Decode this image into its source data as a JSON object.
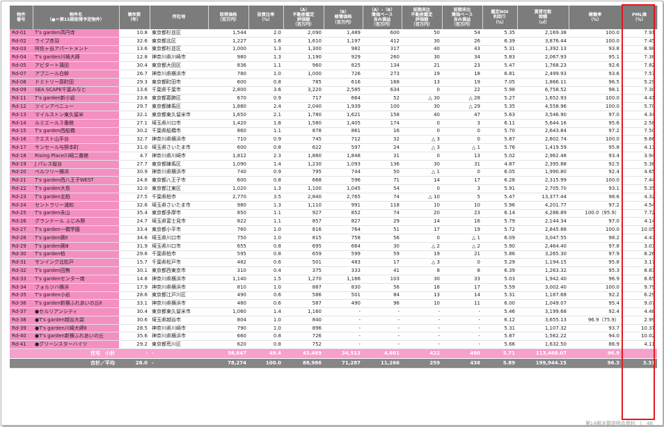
{
  "headers": [
    "物件\n番号",
    "物件名\n（●＝第15期取得予定物件）",
    "築年数\n（年）",
    "所在地",
    "取得価格\n（百万円）",
    "投資比率\n（%）",
    "（A）\n不動産鑑定\n評価額\n（百万円）",
    "（B）\n帳簿価格\n（百万円）",
    "（A）-（B）\n簿価ベース\n含み損益\n（百万円）",
    "前期末比\n不動産鑑定\n評価額\n（百万円）",
    "前期末比\n簿価ベース\n含み損益\n（百万円）",
    "鑑定NOI\n利回り\n（%）",
    "賃貸可能\n面積\n（㎡）",
    "稼働率\n（%）",
    "PML値\n（%）"
  ],
  "rows": [
    [
      "Rd-01",
      "T's garden高円寺",
      "10.8",
      "東京都杉並区",
      "1,544",
      "2.0",
      "2,090",
      "1,489",
      "600",
      "50",
      "54",
      "5.35",
      "2,169.38",
      "100.0",
      "7.91"
    ],
    [
      "Rd-02",
      "ライブ赤羽",
      "32.6",
      "東京都北区",
      "1,227",
      "1.6",
      "1,610",
      "1,197",
      "412",
      "30",
      "26",
      "6.39",
      "3,876.44",
      "100.0",
      "7.45"
    ],
    [
      "Rd-03",
      "阿佐ヶ谷アパートメント",
      "13.6",
      "東京都杉並区",
      "1,000",
      "1.3",
      "1,300",
      "982",
      "317",
      "40",
      "43",
      "5.31",
      "1,392.13",
      "93.8",
      "8.98"
    ],
    [
      "Rd-04",
      "T's garden川崎大師",
      "12.8",
      "神奈川県川崎市",
      "980",
      "1.3",
      "1,190",
      "929",
      "260",
      "30",
      "34",
      "5.83",
      "2,067.93",
      "95.1",
      "7.38"
    ],
    [
      "Rd-05",
      "アビタート蒲田",
      "30.4",
      "東京都大田区",
      "836",
      "1.1",
      "960",
      "825",
      "134",
      "21",
      "23",
      "5.47",
      "1,768.23",
      "92.6",
      "7.82"
    ],
    [
      "Rd-07",
      "アブニール白幹",
      "26.7",
      "神奈川県横浜市",
      "780",
      "1.0",
      "1,000",
      "726",
      "273",
      "19",
      "18",
      "6.81",
      "2,499.93",
      "93.6",
      "7.57"
    ],
    [
      "Rd-08",
      "ドミトリー原町田",
      "29.3",
      "東京都町田市",
      "600",
      "0.8",
      "785",
      "616",
      "168",
      "13",
      "19",
      "7.05",
      "1,866.11",
      "96.5",
      "5.29"
    ],
    [
      "Rd-09",
      "SEA SCAPE千葉みなと",
      "13.6",
      "千葉県千葉市",
      "2,800",
      "3.6",
      "3,220",
      "2,585",
      "634",
      "0",
      "22",
      "5.98",
      "6,758.52",
      "98.1",
      "7.30"
    ],
    [
      "Rd-11",
      "T's garden新小岩",
      "23.6",
      "東京都葛飾区",
      "670",
      "0.9",
      "717",
      "664",
      "52",
      "△ 30",
      "△ 28",
      "5.27",
      "1,652.93",
      "100.0",
      "4.41"
    ],
    [
      "Rd-12",
      "ツインアベニュー",
      "29.7",
      "東京都練馬区",
      "1,880",
      "2.4",
      "2,040",
      "1,939",
      "100",
      "30",
      "△ 29",
      "5.35",
      "4,558.96",
      "100.0",
      "5.70"
    ],
    [
      "Rd-13",
      "マイルストン東久留米",
      "32.1",
      "東京都東久留米市",
      "1,650",
      "2.1",
      "1,780",
      "1,621",
      "158",
      "40",
      "47",
      "5.63",
      "3,546.90",
      "97.0",
      "4.34"
    ],
    [
      "Rd-14",
      "ルミエール３番館",
      "27.1",
      "埼玉県川口市",
      "1,420",
      "1.8",
      "1,580",
      "1,405",
      "174",
      "0",
      "3",
      "6.11",
      "5,644.16",
      "95.6",
      "2.58"
    ],
    [
      "Rd-15",
      "T's garden西船橋",
      "30.2",
      "千葉県船橋市",
      "860",
      "1.1",
      "878",
      "861",
      "16",
      "0",
      "0",
      "5.70",
      "2,643.84",
      "97.2",
      "7.50"
    ],
    [
      "Rd-16",
      "クエスト山手台",
      "32.7",
      "神奈川県横浜市",
      "710",
      "0.9",
      "745",
      "712",
      "32",
      "△ 3",
      "0",
      "5.87",
      "2,802.74",
      "100.0",
      "9.66"
    ],
    [
      "Rd-17",
      "サンセール与野本町",
      "31.0",
      "埼玉県さいたま市",
      "600",
      "0.8",
      "622",
      "597",
      "24",
      "△ 3",
      "△ 1",
      "5.76",
      "1,419.59",
      "95.8",
      "4.13"
    ],
    [
      "Rd-18",
      "Rising Place川崎二番館",
      "4.7",
      "神奈川県川崎市",
      "1,812",
      "2.3",
      "1,880",
      "1,848",
      "31",
      "0",
      "13",
      "5.02",
      "2,962.48",
      "93.4",
      "3.94"
    ],
    [
      "Rd-19",
      "J パレス桜台",
      "27.7",
      "東京都練馬区",
      "1,090",
      "1.4",
      "1,230",
      "1,093",
      "136",
      "30",
      "31",
      "4.87",
      "2,395.88",
      "92.5",
      "5.38"
    ],
    [
      "Rd-20",
      "ベルツリー横浜",
      "30.9",
      "神奈川県横浜市",
      "740",
      "0.9",
      "795",
      "744",
      "50",
      "△ 1",
      "0",
      "6.05",
      "1,990.80",
      "92.4",
      "4.65"
    ],
    [
      "Rd-21",
      "T's garden西八王子WEST",
      "24.8",
      "東京都八王子市",
      "600",
      "0.8",
      "668",
      "596",
      "71",
      "14",
      "17",
      "6.28",
      "2,315.99",
      "100.0",
      "7.44"
    ],
    [
      "Rd-22",
      "T's garden大島",
      "32.0",
      "東京都江東区",
      "1,020",
      "1.3",
      "1,100",
      "1,045",
      "54",
      "0",
      "3",
      "5.91",
      "2,705.70",
      "93.1",
      "5.35"
    ],
    [
      "Rd-23",
      "T's garden北柏",
      "27.5",
      "千葉県柏市",
      "2,770",
      "3.5",
      "2,840",
      "2,765",
      "74",
      "△ 10",
      "5",
      "5.47",
      "13,377.44",
      "98.6",
      "4.32"
    ],
    [
      "Rd-24",
      "セントラリー浦和",
      "32.6",
      "埼玉県さいたま市",
      "980",
      "1.3",
      "1,110",
      "991",
      "118",
      "10",
      "10",
      "5.96",
      "4,201.77",
      "97.2",
      "4.54"
    ],
    [
      "Rd-25",
      "T's garden永山",
      "35.4",
      "東京都多摩市",
      "850",
      "1.1",
      "927",
      "852",
      "74",
      "20",
      "23",
      "6.14",
      "4,286.89",
      "100.0（95.9）",
      "7.72"
    ],
    [
      "Rd-26",
      "グランドール ふじみ野",
      "24.7",
      "埼玉県富士見市",
      "822",
      "1.1",
      "857",
      "827",
      "29",
      "14",
      "16",
      "5.79",
      "2,144.34",
      "97.0",
      "4.14"
    ],
    [
      "Rd-27",
      "T's garden一橋学園",
      "33.4",
      "東京都小平市",
      "760",
      "1.0",
      "816",
      "764",
      "51",
      "17",
      "19",
      "5.72",
      "2,845.88",
      "100.0",
      "10.05"
    ],
    [
      "Rd-28",
      "T's garden蕨Ⅱ",
      "34.6",
      "埼玉県川口市",
      "750",
      "1.0",
      "815",
      "758",
      "56",
      "0",
      "△ 1",
      "6.09",
      "3,047.55",
      "98.2",
      "4.43"
    ],
    [
      "Rd-29",
      "T's garden蕨Ⅲ",
      "31.9",
      "埼玉県川口市",
      "655",
      "0.8",
      "695",
      "664",
      "30",
      "△ 2",
      "△ 2",
      "5.90",
      "2,464.40",
      "97.8",
      "3.03"
    ],
    [
      "Rd-30",
      "T's garden柏",
      "29.6",
      "千葉県柏市",
      "595",
      "0.8",
      "659",
      "599",
      "59",
      "19",
      "21",
      "5.86",
      "3,265.30",
      "97.9",
      "8.26"
    ],
    [
      "Rd-31",
      "サンイング北松戸",
      "15.7",
      "千葉県松戸市",
      "482",
      "0.6",
      "501",
      "483",
      "17",
      "△ 3",
      "0",
      "5.29",
      "1,194.15",
      "95.8",
      "3.17"
    ],
    [
      "Rd-32",
      "T's garden田無",
      "30.1",
      "東京都西東京市",
      "310",
      "0.4",
      "375",
      "333",
      "41",
      "8",
      "8",
      "6.39",
      "1,263.32",
      "95.3",
      "8.83"
    ],
    [
      "Rd-33",
      "T's gardenセンター南",
      "14.8",
      "神奈川県横浜市",
      "1,140",
      "1.5",
      "1,270",
      "1,166",
      "103",
      "30",
      "33",
      "5.03",
      "1,942.40",
      "96.9",
      "8.65"
    ],
    [
      "Rd-34",
      "フォルツハ横浜",
      "17.9",
      "神奈川県横浜市",
      "810",
      "1.0",
      "887",
      "830",
      "56",
      "16",
      "17",
      "5.59",
      "3,002.40",
      "100.0",
      "9.79"
    ],
    [
      "Rd-35",
      "T's garden小岩",
      "28.6",
      "東京都江戸川区",
      "490",
      "0.6",
      "586",
      "501",
      "84",
      "13",
      "14",
      "5.31",
      "1,187.68",
      "92.2",
      "6.29"
    ],
    [
      "Rd-36",
      "T's garden新横ふれあいの丘Ⅱ",
      "33.1",
      "神奈川県横浜市",
      "480",
      "0.6",
      "587",
      "490",
      "96",
      "10",
      "11",
      "6.00",
      "1,049.07",
      "95.4",
      "9.07"
    ],
    [
      "Rd-37",
      "●セルリアンシティ",
      "30.4",
      "東京都東久留米市",
      "1,060",
      "1.4",
      "1,160",
      "-",
      "-",
      "-",
      "-",
      "5.46",
      "3,199.68",
      "92.4",
      "4.48"
    ],
    [
      "Rd-38",
      "●T's garden越谷大袋",
      "30.6",
      "埼玉県越谷市",
      "804",
      "1.0",
      "840",
      "-",
      "-",
      "-",
      "-",
      "6.12",
      "3,655.13",
      "96.9（75.9）",
      "2.99"
    ],
    [
      "Rd-39",
      "●T's garden川崎大師Ⅱ",
      "28.5",
      "神奈川県川崎市",
      "790",
      "1.0",
      "896",
      "-",
      "-",
      "-",
      "-",
      "5.31",
      "1,107.32",
      "93.7",
      "10.31"
    ],
    [
      "Rd-40",
      "●T's garden新横ふれあいの丘",
      "35.6",
      "神奈川県横浜市",
      "660",
      "0.8",
      "726",
      "-",
      "-",
      "-",
      "-",
      "5.87",
      "1,562.22",
      "94.0",
      "10.02"
    ],
    [
      "Rd-41",
      "●グリーンスターハイツ",
      "29.2",
      "東京都荒川区",
      "620",
      "0.8",
      "752",
      "-",
      "-",
      "-",
      "-",
      "5.66",
      "1,632.50",
      "86.9",
      "4.11"
    ]
  ],
  "subtotal": {
    "label": "住宅　小計",
    "values": [
      "-",
      "-",
      "38,647",
      "49.4",
      "43,489",
      "34,513",
      "4,601",
      "422",
      "480",
      "5.71",
      "113,468.07",
      "96.9",
      "-"
    ]
  },
  "total": {
    "label": "合計／平均",
    "values": [
      "28.0",
      "-",
      "78,274",
      "100.0",
      "88,986",
      "71,287",
      "11,266",
      "259",
      "436",
      "5.89",
      "199,944.15",
      "96.3",
      "3.31"
    ]
  },
  "footer": "第14期決算説明会資料　|　48",
  "colors": {
    "header_bg": "#7c7c7c",
    "pink": "#f48fc2",
    "highlight_border": "#e0191e"
  }
}
